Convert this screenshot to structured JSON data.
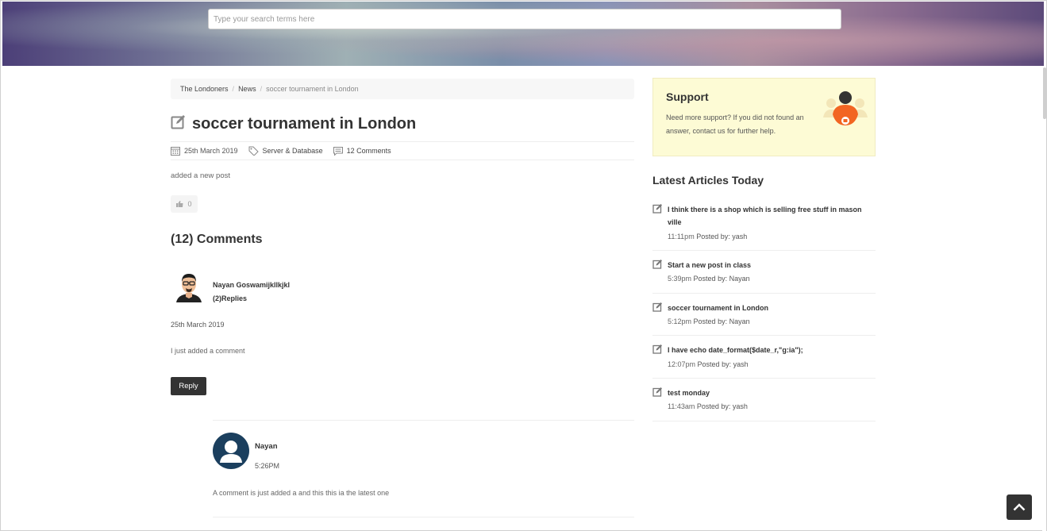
{
  "header": {
    "search_placeholder": "Type your search terms here"
  },
  "breadcrumb": {
    "items": [
      "The Londoners",
      "News"
    ],
    "current": "soccer tournament in London"
  },
  "post": {
    "title": "soccer tournament in London",
    "date": "25th March 2019",
    "category": "Server & Database",
    "comments_link": "12 Comments",
    "body": "added a new post",
    "likes": "0"
  },
  "comments": {
    "heading": "(12) Comments",
    "items": [
      {
        "author": "Nayan Goswamijkllkjkl",
        "replies": "(2)Replies",
        "date": "25th March 2019",
        "text": "I just added a comment",
        "reply_label": "Reply",
        "reply": {
          "author": "Nayan",
          "time": "5:26PM",
          "text": "A comment is just added a and this this ia the latest one"
        }
      }
    ]
  },
  "sidebar": {
    "support": {
      "title": "Support",
      "text": "Need more support? If you did not found an answer, contact us for further help."
    },
    "latest_title": "Latest Articles Today",
    "articles": [
      {
        "title": "I think there is a shop which is selling free stuff in mason ville",
        "time": "11:11pm",
        "posted_by": "Posted by: yash"
      },
      {
        "title": "Start a new post in class",
        "time": "5:39pm",
        "posted_by": "Posted by: Nayan"
      },
      {
        "title": "soccer tournament in London",
        "time": "5:12pm",
        "posted_by": "Posted by: Nayan"
      },
      {
        "title": "I have echo date_format($date_r,\"g:ia\");",
        "time": "12:07pm",
        "posted_by": "Posted by: yash"
      },
      {
        "title": "test monday",
        "time": "11:43am",
        "posted_by": "Posted by: yash"
      }
    ]
  },
  "colors": {
    "accent_dark": "#333333",
    "support_bg": "#fdfbd5",
    "support_icon_orange": "#f26522"
  },
  "icons": [
    "edit-icon",
    "calendar-icon",
    "tag-icon",
    "comment-icon",
    "thumbs-up-icon",
    "chevron-up-icon",
    "support-agent-icon",
    "user-avatar-icon"
  ]
}
